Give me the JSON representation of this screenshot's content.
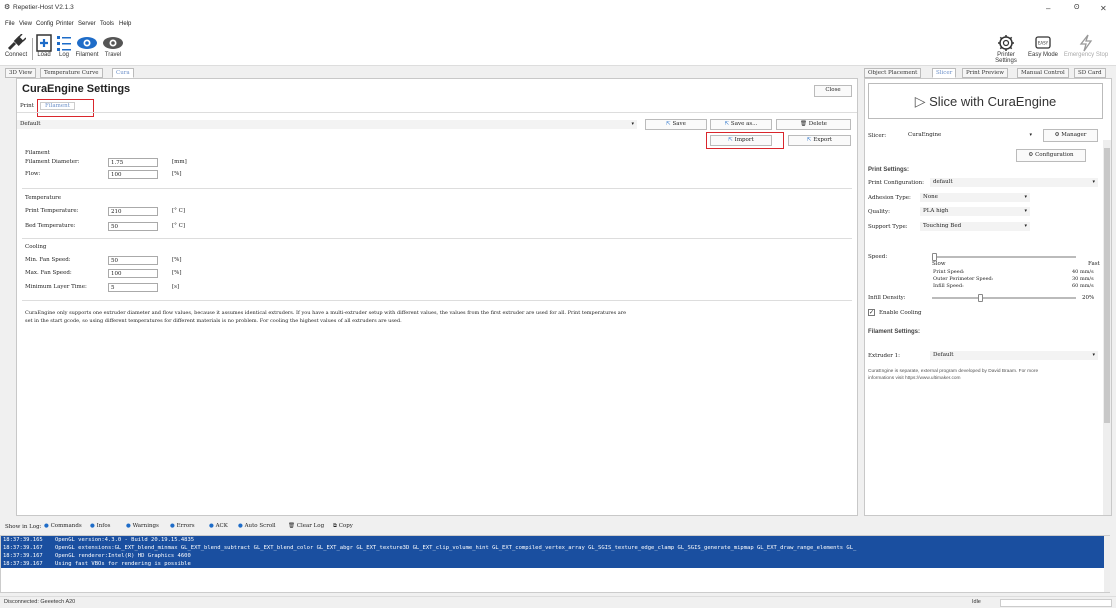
{
  "window": {
    "title": "Repetier-Host V2.1.3",
    "minimize": "–",
    "maximize": "ʘ",
    "close": "✕"
  },
  "menu": [
    "File",
    "View",
    "Config",
    "Printer",
    "Server",
    "Tools",
    "Help"
  ],
  "toolbar": {
    "left": [
      {
        "label": "Connect",
        "icon": "plug-icon"
      },
      {
        "label": "Load",
        "icon": "load-file-icon"
      },
      {
        "label": "Log",
        "icon": "log-list-icon"
      },
      {
        "label": "Filament",
        "icon": "filament-eye-icon"
      },
      {
        "label": "Travel",
        "icon": "travel-eye-icon"
      }
    ],
    "right": [
      {
        "label": "Printer Settings",
        "icon": "printer-settings-gear-icon"
      },
      {
        "label": "Easy Mode",
        "icon": "easy-mode-icon"
      },
      {
        "label": "Emergency Stop",
        "icon": "emergency-stop-lightning-icon"
      }
    ]
  },
  "left_tabs": [
    "3D View",
    "Temperature Curve",
    "Cura"
  ],
  "cura": {
    "title": "CuraEngine Settings",
    "close": "Close",
    "subtabs": [
      "Print",
      "Filament"
    ],
    "profile": "Default",
    "buttons": {
      "save": "Save",
      "save_as": "Save as...",
      "delete": "Delete",
      "import": "Import",
      "export": "Export"
    },
    "filament": {
      "heading": "Filament",
      "diameter_label": "Filament Diameter:",
      "diameter_value": "1.75",
      "diameter_unit": "[mm]",
      "flow_label": "Flow:",
      "flow_value": "100",
      "flow_unit": "[%]"
    },
    "temperature": {
      "heading": "Temperature",
      "print_label": "Print Temperature:",
      "print_value": "210",
      "print_unit": "[° C]",
      "bed_label": "Bed Temperature:",
      "bed_value": "50",
      "bed_unit": "[° C]"
    },
    "cooling": {
      "heading": "Cooling",
      "min_label": "Min. Fan Speed:",
      "min_value": "50",
      "min_unit": "[%]",
      "max_label": "Max. Fan Speed:",
      "max_value": "100",
      "max_unit": "[%]",
      "layer_label": "Minimum Layer Time:",
      "layer_value": "5",
      "layer_unit": "[s]"
    },
    "note_1": "CuraEngine only supports one extruder diameter and flow values, because it assumes identical extruders. If you have a multi-extruder setup with different values, the values from the first extruder are used for all. Print temperatures are",
    "note_2": "set in the start gcode, so using different temperatures for different materials is no problem. For cooling the highest values of all extruders are used."
  },
  "right_tabs": [
    "Object Placement",
    "Slicer",
    "Print Preview",
    "Manual Control",
    "SD Card"
  ],
  "slicer": {
    "slice_button": "Slice with CuraEngine",
    "slicer_label": "Slicer:",
    "slicer_value": "CuraEngine",
    "manager": "Manager",
    "configuration": "Configuration",
    "print_settings": "Print Settings:",
    "print_config_label": "Print Configuration:",
    "print_config_value": "default",
    "adhesion_label": "Adhesion Type:",
    "adhesion_value": "None",
    "quality_label": "Quality:",
    "quality_value": "PLA high",
    "support_label": "Support Type:",
    "support_value": "Touching Bed",
    "speed_label": "Speed:",
    "slow": "Slow",
    "fast": "Fast",
    "print_speed_label": "Print Speed:",
    "print_speed_value": "40 mm/s",
    "outer_speed_label": "Outer Perimeter Speed:",
    "outer_speed_value": "30 mm/s",
    "infill_speed_label": "Infill Speed:",
    "infill_speed_value": "60 mm/s",
    "infill_density_label": "Infill Density:",
    "infill_density_value": "20%",
    "infill_density_fraction": 0.33,
    "speed_fraction": 0.0,
    "enable_cooling": "Enable Cooling",
    "filament_settings": "Filament Settings:",
    "extruder_label": "Extruder 1:",
    "extruder_value": "Default",
    "info_1": "CuraEngine is separate, external program developed by David Braam. For more",
    "info_2": "informations visit https://www.ultimaker.com"
  },
  "log_toolbar": {
    "show_in_log": "Show in Log:",
    "items": [
      "Commands",
      "Infos",
      "Warnings",
      "Errors",
      "ACK",
      "Auto Scroll"
    ],
    "clear": "Clear Log",
    "copy": "Copy"
  },
  "log_lines": [
    {
      "time": "18:37:39.165",
      "text": "OpenGL version:4.3.0 - Build 20.19.15.4835"
    },
    {
      "time": "18:37:39.167",
      "text": "OpenGL extensions:GL_EXT_blend_minmax GL_EXT_blend_subtract GL_EXT_blend_color GL_EXT_abgr GL_EXT_texture3D GL_EXT_clip_volume_hint GL_EXT_compiled_vertex_array GL_SGIS_texture_edge_clamp GL_SGIS_generate_mipmap GL_EXT_draw_range_elements GL_"
    },
    {
      "time": "18:37:39.167",
      "text": "OpenGL renderer:Intel(R) HD Graphics 4600"
    },
    {
      "time": "18:37:39.167",
      "text": "Using fast VBOs for rendering is possible"
    }
  ],
  "status": {
    "left": "Disconnected: Geeetech A20",
    "right": "Idle"
  },
  "colors": {
    "accent_blue": "#1e6cc8",
    "highlight_red": "#d9262c",
    "log_bg": "#1a4fa0"
  }
}
